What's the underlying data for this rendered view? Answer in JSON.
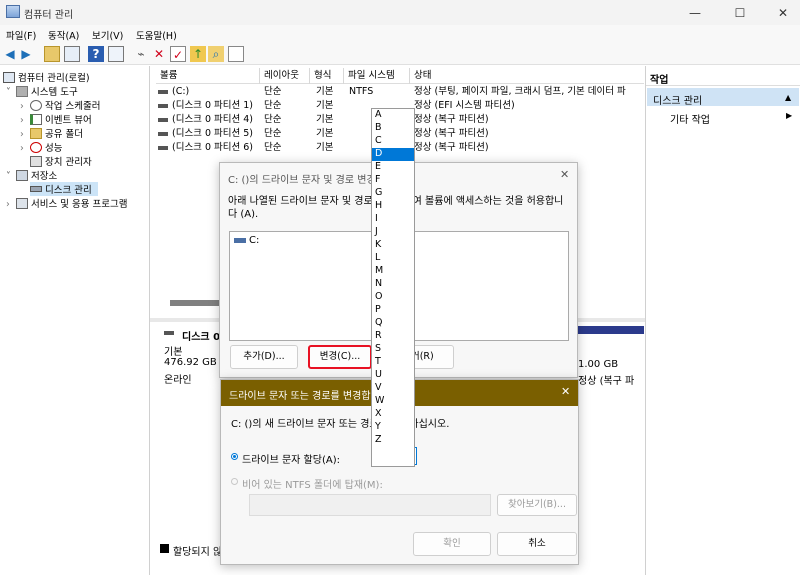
{
  "window": {
    "title": "컴퓨터 관리",
    "min": "—",
    "max": "☐",
    "close": "✕"
  },
  "menu": [
    "파일(F)",
    "동작(A)",
    "보기(V)",
    "도움말(H)"
  ],
  "tree": [
    {
      "label": "컴퓨터 관리(로컬)",
      "indent": 0,
      "arrow": ""
    },
    {
      "label": "시스템 도구",
      "indent": 1,
      "arrow": "˅"
    },
    {
      "label": "작업 스케줄러",
      "indent": 2,
      "arrow": "›"
    },
    {
      "label": "이벤트 뷰어",
      "indent": 2,
      "arrow": "›"
    },
    {
      "label": "공유 폴더",
      "indent": 2,
      "arrow": "›"
    },
    {
      "label": "성능",
      "indent": 2,
      "arrow": "›"
    },
    {
      "label": "장치 관리자",
      "indent": 2,
      "arrow": ""
    },
    {
      "label": "저장소",
      "indent": 1,
      "arrow": "˅"
    },
    {
      "label": "디스크 관리",
      "indent": 2,
      "arrow": ""
    },
    {
      "label": "서비스 및 응용 프로그램",
      "indent": 1,
      "arrow": "›"
    }
  ],
  "table": {
    "headers": [
      "볼륨",
      "레이아웃",
      "형식",
      "파일 시스템",
      "상태"
    ],
    "rows": [
      [
        "(C:)",
        "단순",
        "기본",
        "NTFS",
        "정상 (부팅, 페이지 파일, 크래시 덤프, 기본 데이터 파"
      ],
      [
        "(디스크 0 파티션 1)",
        "단순",
        "기본",
        "",
        "정상 (EFI 시스템 파티션)"
      ],
      [
        "(디스크 0 파티션 4)",
        "단순",
        "기본",
        "",
        "정상 (복구 파티션)"
      ],
      [
        "(디스크 0 파티션 5)",
        "단순",
        "기본",
        "",
        "정상 (복구 파티션)"
      ],
      [
        "(디스크 0 파티션 6)",
        "단순",
        "기본",
        "",
        "정상 (복구 파티션)"
      ]
    ]
  },
  "disk": {
    "name": "디스크 0",
    "type": "기본",
    "size": "476.92 GB",
    "status": "온라인",
    "part_size": "1.00 GB",
    "part_status": "정상 (복구 파",
    "unalloc": "할당되지 않음"
  },
  "actions": {
    "header": "작업",
    "section": "디스크 관리",
    "item": "기타 작업"
  },
  "dialog1": {
    "title": "C: ()의 드라이브 문자 및 경로 변경",
    "desc": "아래 나열된 드라이브 문자 및 경로를 사용하여 볼륨에 액세스하는 것을 허용합니다 (A).",
    "list_item": "C:",
    "add": "추가(D)...",
    "change": "변경(C)...",
    "remove": "제거(R)"
  },
  "dialog2": {
    "title": "드라이브 문자 또는 경로를 변경합니다",
    "desc": "C: ()의 새 드라이브 문자 또는 경로를 지정하십시오.",
    "radio1": "드라이브 문자 할당(A):",
    "radio2": "비어 있는 NTFS 폴더에 탑재(M):",
    "browse": "찾아보기(B)...",
    "ok": "확인",
    "cancel": "취소",
    "selected_letter": "C"
  },
  "letters": [
    "A",
    "B",
    "C",
    "D",
    "E",
    "F",
    "G",
    "H",
    "I",
    "J",
    "K",
    "L",
    "M",
    "N",
    "O",
    "P",
    "Q",
    "R",
    "S",
    "T",
    "U",
    "V",
    "W",
    "X",
    "Y",
    "Z"
  ],
  "highlighted_letter": "D",
  "colors": {
    "accent": "#0078d7",
    "dialog2_title": "#7a5f00",
    "highlight_box": "#e81123",
    "disk_bar": "#2b3a8c"
  }
}
